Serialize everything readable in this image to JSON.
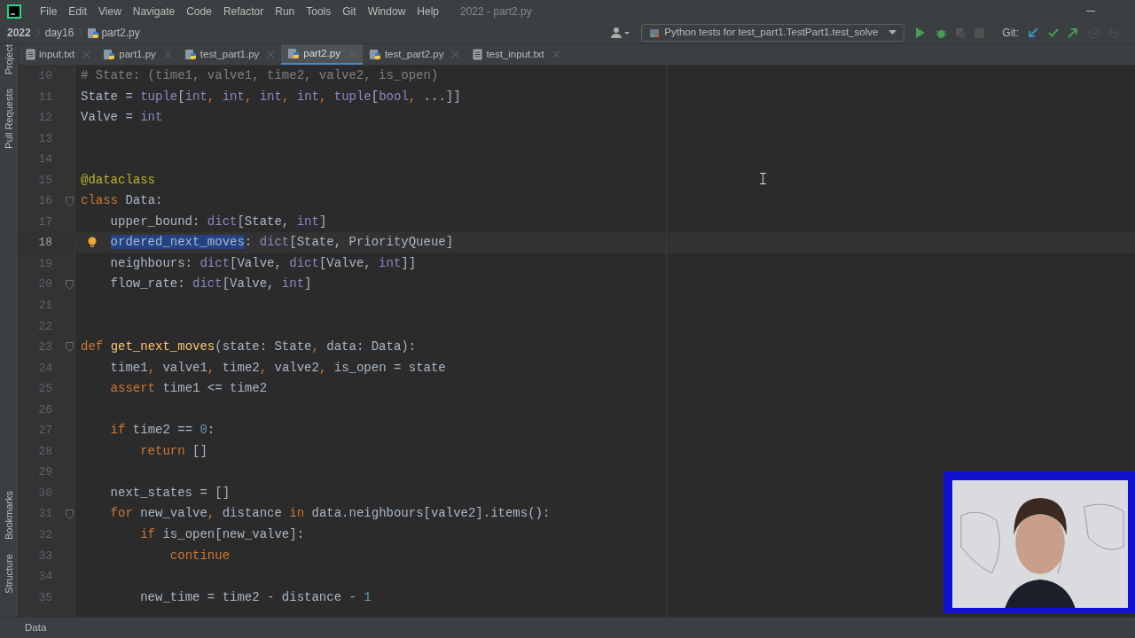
{
  "menu": [
    "File",
    "Edit",
    "View",
    "Navigate",
    "Code",
    "Refactor",
    "Run",
    "Tools",
    "Git",
    "Window",
    "Help"
  ],
  "window": {
    "title": "2022 - part2.py"
  },
  "breadcrumb": [
    {
      "label": "2022",
      "kind": "folder"
    },
    {
      "label": "day16",
      "kind": "folder"
    },
    {
      "label": "part2.py",
      "kind": "python"
    }
  ],
  "toolbar": {
    "run_config": "Python tests for test_part1.TestPart1.test_solve",
    "git_label": "Git:"
  },
  "tool_windows_top": [
    "Project",
    "Pull Requests"
  ],
  "tool_windows_bottom": [
    "Bookmarks",
    "Structure"
  ],
  "tabs": [
    {
      "label": "input.txt",
      "kind": "text",
      "selected": false
    },
    {
      "label": "part1.py",
      "kind": "python",
      "selected": false
    },
    {
      "label": "test_part1.py",
      "kind": "python",
      "selected": false
    },
    {
      "label": "part2.py",
      "kind": "python",
      "selected": true
    },
    {
      "label": "test_part2.py",
      "kind": "python",
      "selected": false
    },
    {
      "label": "test_input.txt",
      "kind": "text",
      "selected": false
    }
  ],
  "editor": {
    "lines": [
      {
        "number": "10",
        "current": false,
        "fold": false,
        "tokens": [
          {
            "kind": "comment",
            "text": "# State: (time1, valve1, time2, valve2, is_open)"
          }
        ]
      },
      {
        "number": "11",
        "current": false,
        "fold": false,
        "tokens": [
          {
            "kind": "plain",
            "text": "State = "
          },
          {
            "kind": "builtin",
            "text": "tuple"
          },
          {
            "kind": "plain",
            "text": "["
          },
          {
            "kind": "builtin",
            "text": "int"
          },
          {
            "kind": "punct",
            "text": ", "
          },
          {
            "kind": "builtin",
            "text": "int"
          },
          {
            "kind": "punct",
            "text": ", "
          },
          {
            "kind": "builtin",
            "text": "int"
          },
          {
            "kind": "punct",
            "text": ", "
          },
          {
            "kind": "builtin",
            "text": "int"
          },
          {
            "kind": "punct",
            "text": ", "
          },
          {
            "kind": "builtin",
            "text": "tuple"
          },
          {
            "kind": "plain",
            "text": "["
          },
          {
            "kind": "builtin",
            "text": "bool"
          },
          {
            "kind": "punct",
            "text": ", "
          },
          {
            "kind": "plain",
            "text": "...]]"
          }
        ]
      },
      {
        "number": "12",
        "current": false,
        "fold": false,
        "tokens": [
          {
            "kind": "plain",
            "text": "Valve = "
          },
          {
            "kind": "builtin",
            "text": "int"
          }
        ]
      },
      {
        "number": "13",
        "current": false,
        "fold": false
      },
      {
        "number": "14",
        "current": false,
        "fold": false
      },
      {
        "number": "15",
        "current": false,
        "fold": false,
        "tokens": [
          {
            "kind": "decorator",
            "text": "@dataclass"
          }
        ]
      },
      {
        "number": "16",
        "current": false,
        "fold": true,
        "tokens": [
          {
            "kind": "keyword",
            "text": "class"
          },
          {
            "kind": "plain",
            "text": " Data:"
          }
        ]
      },
      {
        "number": "17",
        "current": false,
        "fold": false,
        "tokens": [
          {
            "kind": "plain",
            "text": "    upper_bound: "
          },
          {
            "kind": "builtin",
            "text": "dict"
          },
          {
            "kind": "plain",
            "text": "[State, "
          },
          {
            "kind": "builtin",
            "text": "int"
          },
          {
            "kind": "plain",
            "text": "]"
          }
        ]
      },
      {
        "number": "18",
        "current": true,
        "fold": false,
        "tokens": [
          {
            "kind": "selection",
            "text": "    ordered_next_moves"
          },
          {
            "kind": "plain",
            "text": ": "
          },
          {
            "kind": "builtin",
            "text": "dict"
          },
          {
            "kind": "plain",
            "text": "[State, PriorityQueue]"
          }
        ]
      },
      {
        "number": "19",
        "current": false,
        "fold": false,
        "tokens": [
          {
            "kind": "plain",
            "text": "    neighbours: "
          },
          {
            "kind": "builtin",
            "text": "dict"
          },
          {
            "kind": "plain",
            "text": "[Valve, "
          },
          {
            "kind": "builtin",
            "text": "dict"
          },
          {
            "kind": "plain",
            "text": "[Valve, "
          },
          {
            "kind": "builtin",
            "text": "int"
          },
          {
            "kind": "plain",
            "text": "]]"
          }
        ]
      },
      {
        "number": "20",
        "current": false,
        "fold": true,
        "tokens": [
          {
            "kind": "plain",
            "text": "    flow_rate: "
          },
          {
            "kind": "builtin",
            "text": "dict"
          },
          {
            "kind": "plain",
            "text": "[Valve, "
          },
          {
            "kind": "builtin",
            "text": "int"
          },
          {
            "kind": "plain",
            "text": "]"
          }
        ]
      },
      {
        "number": "21",
        "current": false,
        "fold": false
      },
      {
        "number": "22",
        "current": false,
        "fold": false
      },
      {
        "number": "23",
        "current": false,
        "fold": true,
        "tokens": [
          {
            "kind": "keyword",
            "text": "def"
          },
          {
            "kind": "function",
            "text": " get_next_moves"
          },
          {
            "kind": "plain",
            "text": "(state: State"
          },
          {
            "kind": "punct",
            "text": ", "
          },
          {
            "kind": "plain",
            "text": "data: Data):"
          }
        ]
      },
      {
        "number": "24",
        "current": false,
        "fold": false,
        "tokens": [
          {
            "kind": "plain",
            "text": "    time1"
          },
          {
            "kind": "punct",
            "text": ", "
          },
          {
            "kind": "plain",
            "text": "valve1"
          },
          {
            "kind": "punct",
            "text": ", "
          },
          {
            "kind": "plain",
            "text": "time2"
          },
          {
            "kind": "punct",
            "text": ", "
          },
          {
            "kind": "plain",
            "text": "valve2"
          },
          {
            "kind": "punct",
            "text": ", "
          },
          {
            "kind": "plain",
            "text": "is_open = state"
          }
        ]
      },
      {
        "number": "25",
        "current": false,
        "fold": false,
        "tokens": [
          {
            "kind": "keyword",
            "text": "    assert"
          },
          {
            "kind": "plain",
            "text": " time1 <= time2"
          }
        ]
      },
      {
        "number": "26",
        "current": false,
        "fold": false
      },
      {
        "number": "27",
        "current": false,
        "fold": false,
        "tokens": [
          {
            "kind": "keyword",
            "text": "    if"
          },
          {
            "kind": "plain",
            "text": " time2 == "
          },
          {
            "kind": "number",
            "text": "0"
          },
          {
            "kind": "plain",
            "text": ":"
          }
        ]
      },
      {
        "number": "28",
        "current": false,
        "fold": false,
        "tokens": [
          {
            "kind": "keyword",
            "text": "        return"
          },
          {
            "kind": "plain",
            "text": " []"
          }
        ]
      },
      {
        "number": "29",
        "current": false,
        "fold": false
      },
      {
        "number": "30",
        "current": false,
        "fold": false,
        "tokens": [
          {
            "kind": "plain",
            "text": "    next_states = []"
          }
        ]
      },
      {
        "number": "31",
        "current": false,
        "fold": true,
        "tokens": [
          {
            "kind": "keyword",
            "text": "    for"
          },
          {
            "kind": "plain",
            "text": " new_valve"
          },
          {
            "kind": "punct",
            "text": ", "
          },
          {
            "kind": "plain",
            "text": "distance "
          },
          {
            "kind": "keyword",
            "text": "in"
          },
          {
            "kind": "plain",
            "text": " data.neighbours[valve2].items():"
          }
        ]
      },
      {
        "number": "32",
        "current": false,
        "fold": false,
        "tokens": [
          {
            "kind": "keyword",
            "text": "        if"
          },
          {
            "kind": "plain",
            "text": " is_open[new_valve]:"
          }
        ]
      },
      {
        "number": "33",
        "current": false,
        "fold": false,
        "tokens": [
          {
            "kind": "keyword",
            "text": "            continue"
          }
        ]
      },
      {
        "number": "34",
        "current": false,
        "fold": false
      },
      {
        "number": "35",
        "current": false,
        "fold": false,
        "tokens": [
          {
            "kind": "plain",
            "text": "        new_time = time2 - distance - "
          },
          {
            "kind": "number",
            "text": "1"
          }
        ]
      }
    ]
  },
  "webcam": {
    "kind": "picture"
  },
  "status_bar": {
    "breadcrumb": "Data"
  }
}
